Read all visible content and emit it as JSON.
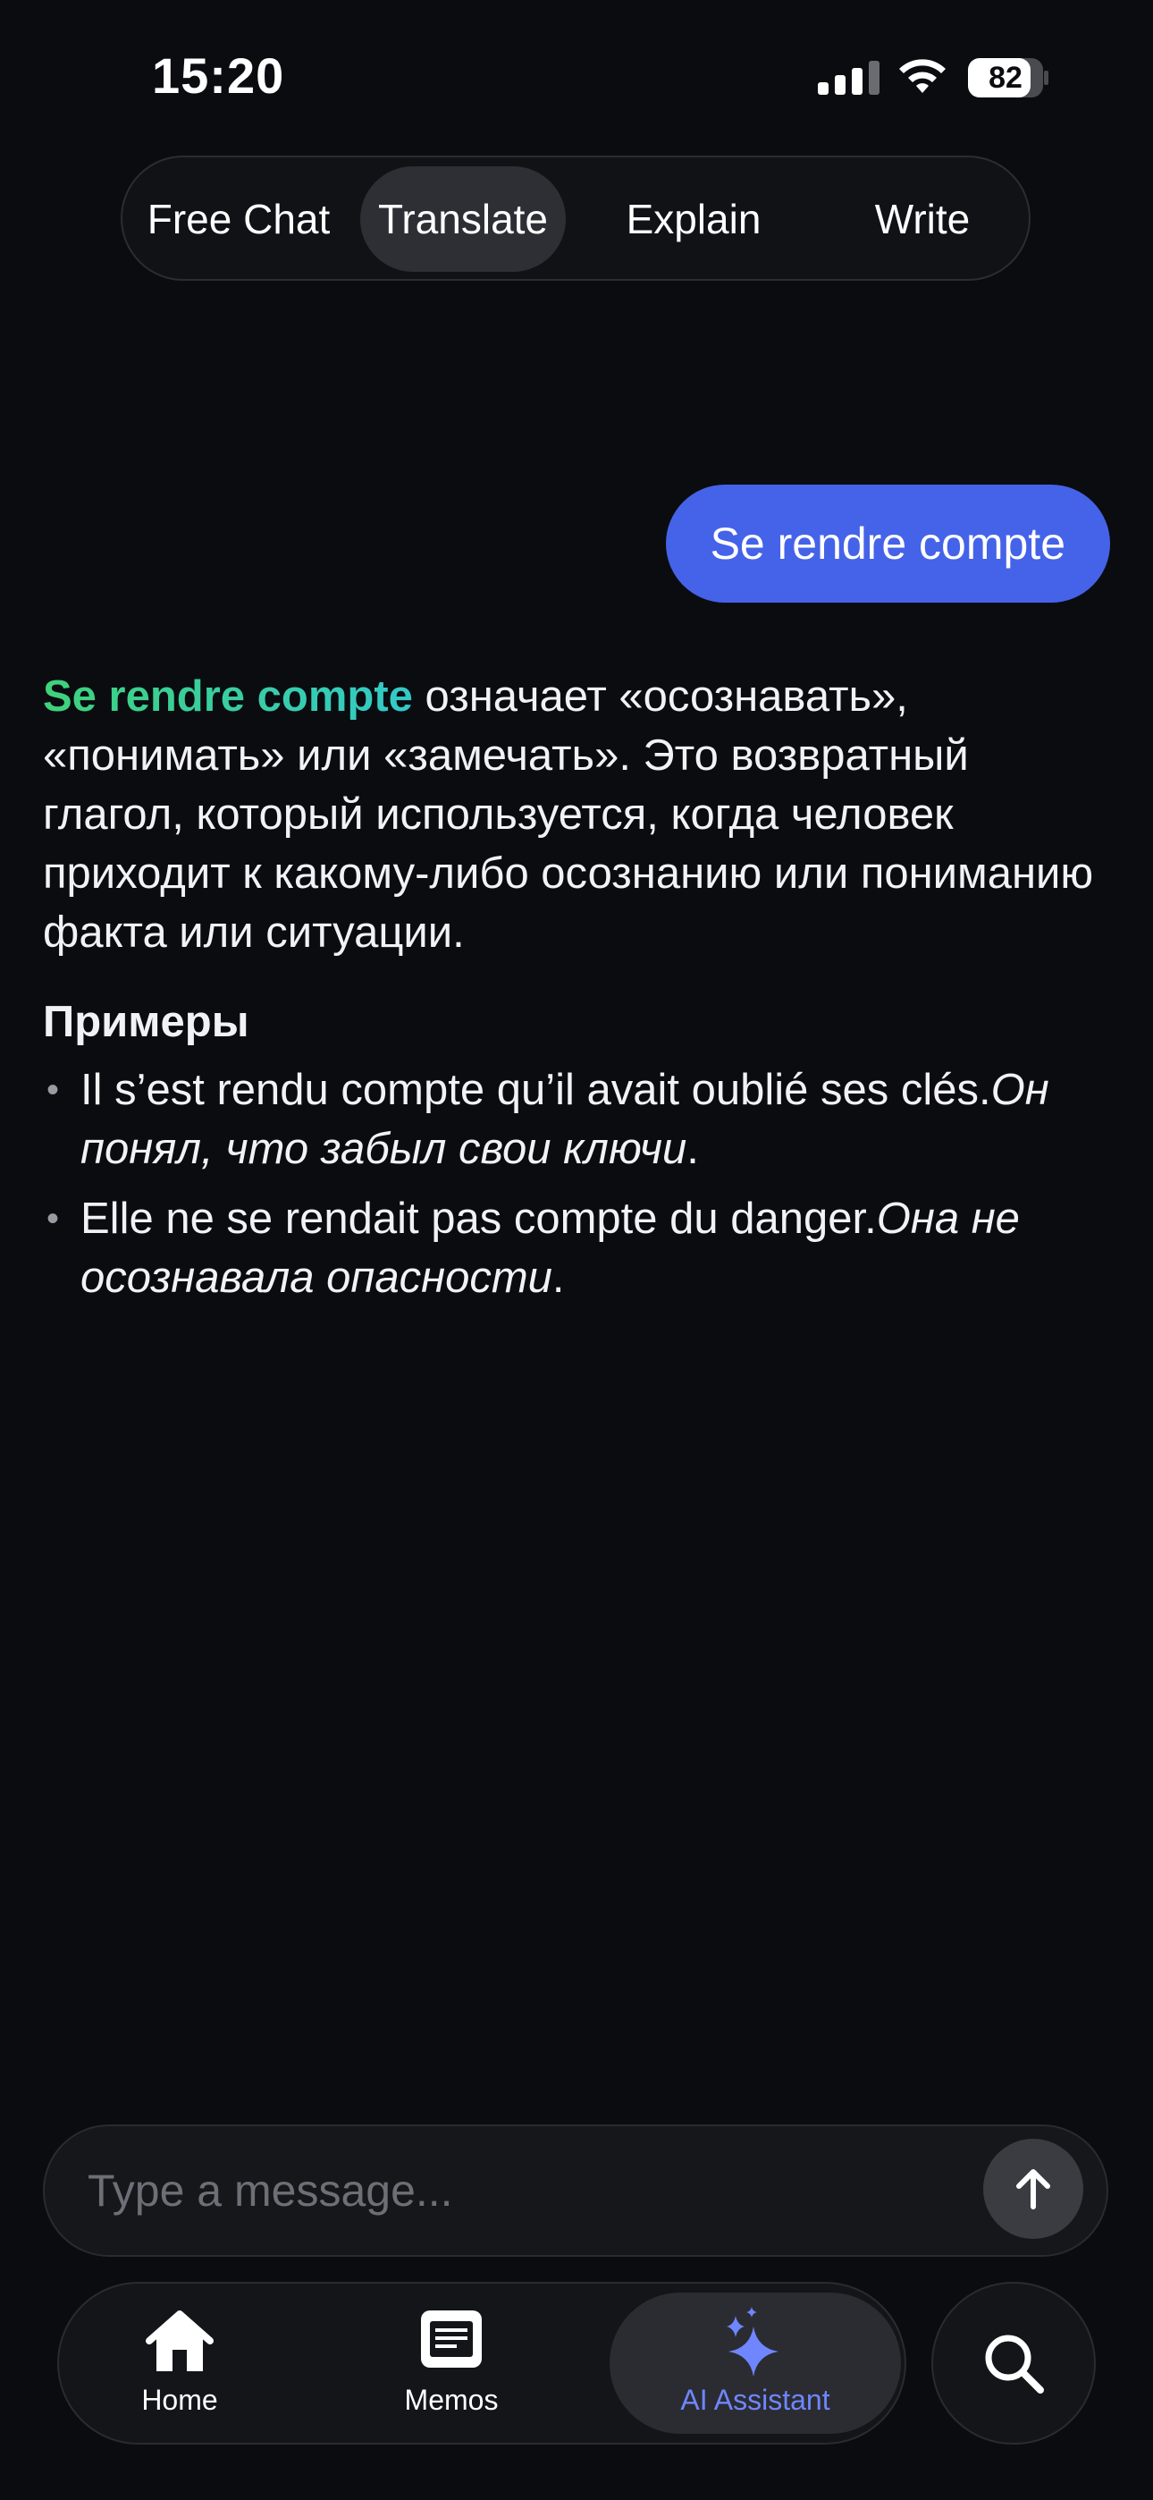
{
  "status_bar": {
    "time": "15:20",
    "battery": "82"
  },
  "tabs": [
    {
      "label": "Free Chat",
      "active": false
    },
    {
      "label": "Translate",
      "active": true
    },
    {
      "label": "Explain",
      "active": false
    },
    {
      "label": "Write",
      "active": false
    }
  ],
  "user_message": "Se rendre compte",
  "answer": {
    "term": "Se rendre compte",
    "definition": " означает «осознавать», «понимать» или «замечать». Это возвратный глагол, который используется, когда человек приходит к какому-либо осознанию или пониманию факта или ситуации.",
    "examples_heading": "Примеры",
    "examples": [
      {
        "source": "Il s’est rendu compte qu’il avait oublié ses clés.",
        "translation": "Он понял, что забыл свои ключи",
        "end": "."
      },
      {
        "source": "Elle ne se rendait pas compte du danger.",
        "translation": "Она не осознавала опасности",
        "end": "."
      }
    ]
  },
  "input": {
    "placeholder": "Type a message..."
  },
  "nav": {
    "items": [
      {
        "label": "Home",
        "icon": "home-icon",
        "active": false
      },
      {
        "label": "Memos",
        "icon": "memo-icon",
        "active": false
      },
      {
        "label": "AI Assistant",
        "icon": "sparkles-icon",
        "active": true
      }
    ]
  },
  "colors": {
    "accent": "#4563e8",
    "active_nav": "#6f86ff",
    "term_start": "#3fd27a",
    "term_end": "#33c9c9",
    "background": "#0b0c10"
  }
}
